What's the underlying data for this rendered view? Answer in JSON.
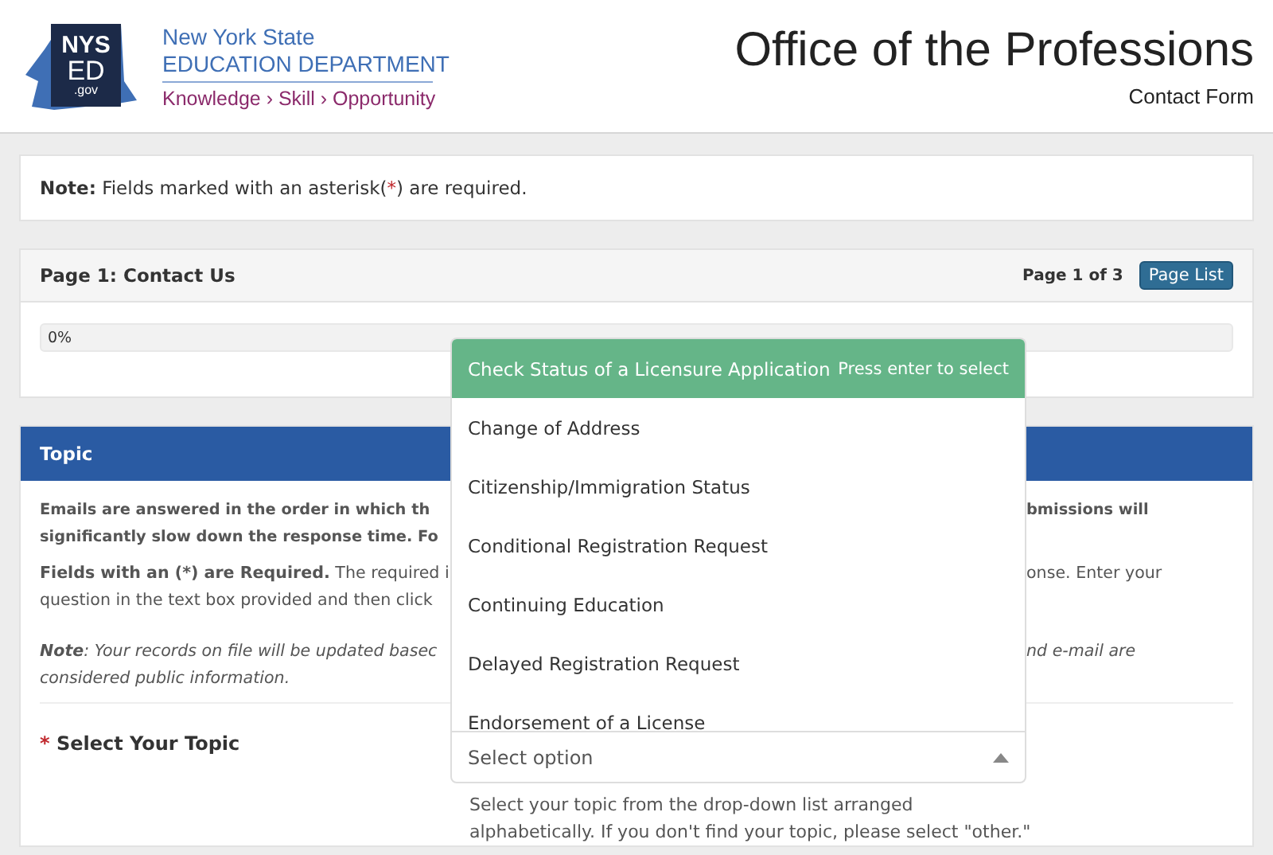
{
  "header": {
    "logo": {
      "line_1": "NYS",
      "line_2": "ED",
      "line_3": ".gov"
    },
    "agency": {
      "name_1": "New York State",
      "name_2": "EDUCATION DEPARTMENT",
      "tagline": "Knowledge › Skill › Opportunity"
    },
    "title": "Office of the Professions",
    "subtitle": "Contact Form"
  },
  "note": {
    "text": "**Note:** Fields marked with an asterisk(",
    "mark": "*",
    "after": ") are required."
  },
  "page_panel": {
    "title": "Page 1: Contact Us",
    "page_count": "Page 1 of 3",
    "button": "Page List",
    "progress": {
      "level": 0,
      "reading": "0%"
    }
  },
  "topic_panel": {
    "title": "Topic",
    "paragraphs": [
      {
        "kind": "bold",
        "left_lines": [
          "Emails are answered in the order in which th",
          "significantly slow down the response time. Fo"
        ],
        "right_lines": [
          "bmissions will"
        ]
      },
      {
        "kind": "plain",
        "left_lines": [
          "**Fields with an (*) are Required.** The required i",
          "question in the text box provided and then click"
        ],
        "right_lines": [
          "onse. Enter your"
        ]
      },
      {
        "kind": "italic",
        "left_lines": [
          "**Note**: Your records on file will be updated basec",
          "considered public information."
        ],
        "right_lines": [
          "nd e-mail are"
        ]
      }
    ],
    "field": {
      "required_mark": "*",
      "label": "Select Your Topic",
      "placeholder": "Select option",
      "expanded": true,
      "help": [
        "Select your topic from the drop-down list arranged",
        "alphabetically. If you don't find your topic, please select \"other.\""
      ],
      "options_hint": "Press enter to select",
      "options": [
        {
          "label": "Check Status of a Licensure Application",
          "selected": true
        },
        {
          "label": "Change of Address",
          "selected": false
        },
        {
          "label": "Citizenship/Immigration Status",
          "selected": false
        },
        {
          "label": "Conditional Registration Request",
          "selected": false
        },
        {
          "label": "Continuing Education",
          "selected": false
        },
        {
          "label": "Delayed Registration Request",
          "selected": false
        },
        {
          "label": "Endorsement of a License",
          "selected": false
        }
      ]
    }
  }
}
